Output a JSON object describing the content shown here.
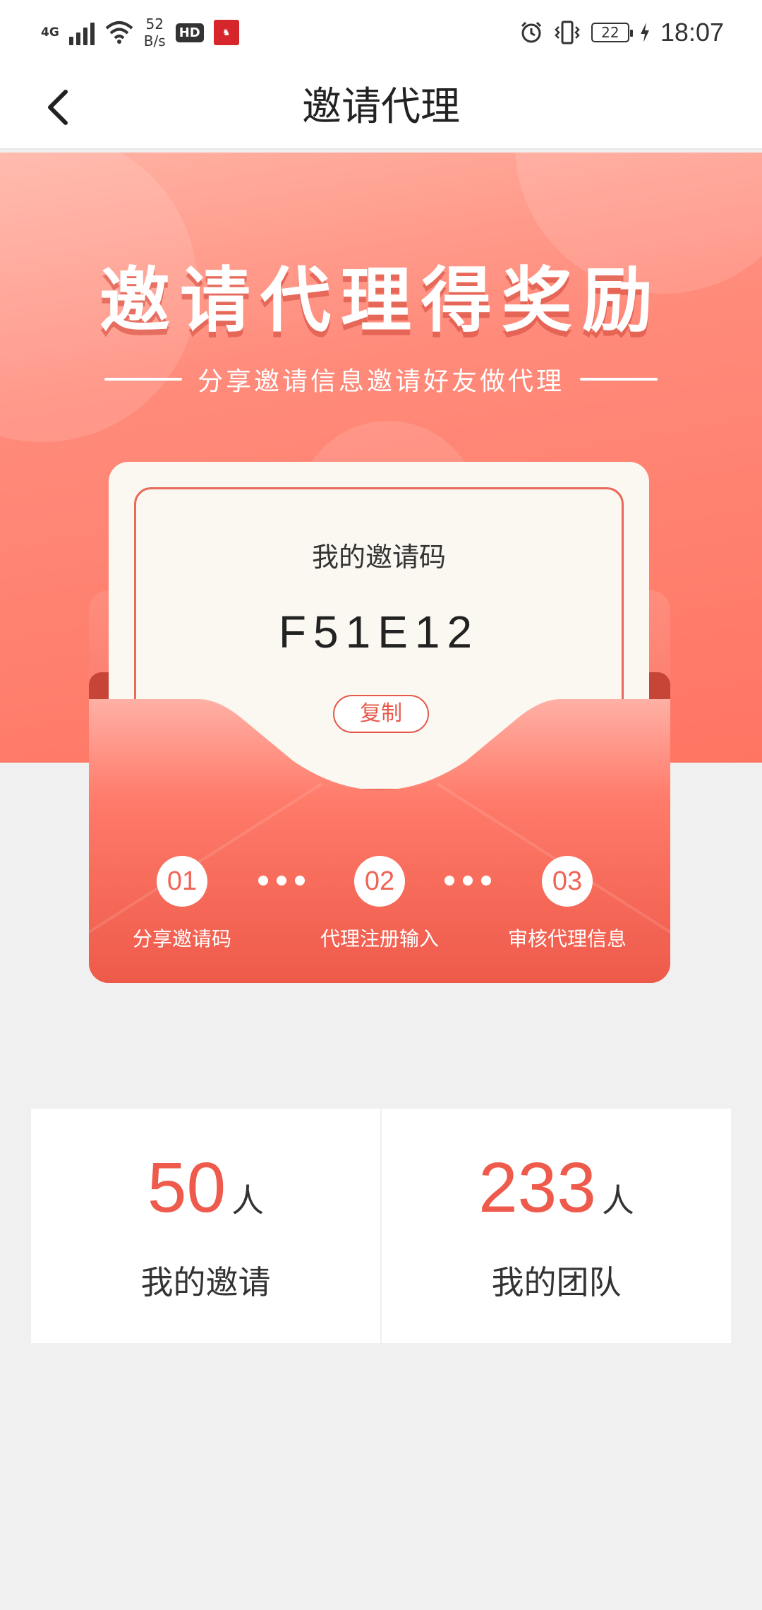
{
  "status_bar": {
    "network": "4G",
    "speed_value": "52",
    "speed_unit": "B/s",
    "hd": "HD",
    "battery": "22",
    "time": "18:07",
    "icons": [
      "signal-icon",
      "wifi-icon",
      "app-icon",
      "alarm-icon",
      "vibrate-icon",
      "battery-icon",
      "charging-icon"
    ]
  },
  "nav": {
    "title": "邀请代理",
    "back_icon": "chevron-left-icon"
  },
  "hero": {
    "title": "邀请代理得奖励",
    "subtitle": "分享邀请信息邀请好友做代理"
  },
  "invite": {
    "label": "我的邀请码",
    "code": "F51E12",
    "copy_label": "复制"
  },
  "steps": [
    {
      "num": "01",
      "label": "分享邀请码"
    },
    {
      "num": "02",
      "label": "代理注册输入"
    },
    {
      "num": "03",
      "label": "审核代理信息"
    }
  ],
  "stats": {
    "invites": {
      "value": "50",
      "unit": "人",
      "label": "我的邀请"
    },
    "team": {
      "value": "233",
      "unit": "人",
      "label": "我的团队"
    }
  },
  "colors": {
    "accent": "#ee5a4b",
    "hero_top": "#ffb3a4",
    "hero_bottom": "#ff7562",
    "card_bg": "#fbf7f1",
    "page_bg": "#f0f0f0"
  }
}
